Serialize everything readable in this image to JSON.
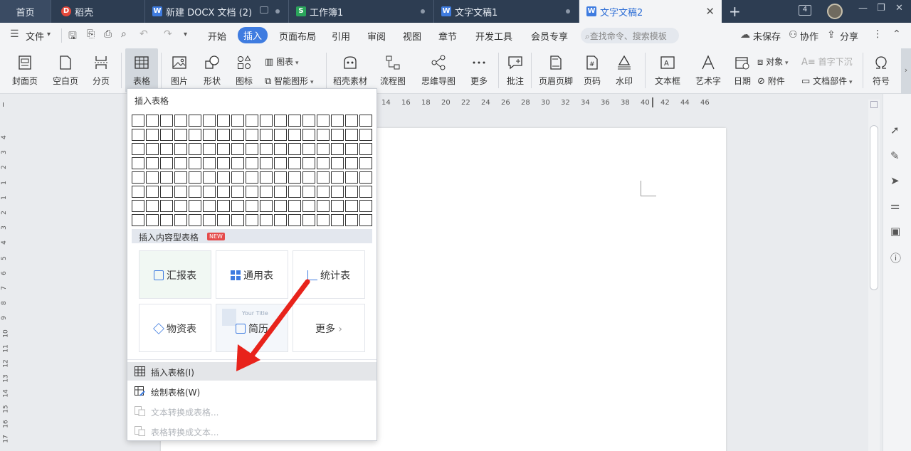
{
  "tabs": {
    "home": "首页",
    "daoke": "稻壳",
    "doc_new": "新建 DOCX 文档 (2)",
    "workbook": "工作簿1",
    "wendoc1": "文字文稿1",
    "wendoc2": "文字文稿2",
    "add": "+",
    "badge_count": "4"
  },
  "menubar": {
    "file": "文件",
    "items": [
      "开始",
      "插入",
      "页面布局",
      "引用",
      "审阅",
      "视图",
      "章节",
      "开发工具",
      "会员专享"
    ],
    "active": "插入",
    "search_placeholder": "查找命令、搜索模板",
    "unsaved": "未保存",
    "collab": "协作",
    "share": "分享"
  },
  "ribbon": {
    "cover": "封面页",
    "blank": "空白页",
    "pagebreak": "分页",
    "table": "表格",
    "picture": "图片",
    "shape": "形状",
    "icon": "图标",
    "chart": "图表",
    "smartart": "智能图形",
    "daoke_material": "稻壳素材",
    "flowchart": "流程图",
    "mindmap": "思维导图",
    "more": "更多",
    "comment": "批注",
    "header_footer": "页眉页脚",
    "page_number": "页码",
    "watermark": "水印",
    "textbox": "文本框",
    "wordart": "艺术字",
    "date": "日期",
    "object": "对象",
    "attachment": "附件",
    "dropcap": "首字下沉",
    "docpart": "文档部件",
    "symbol": "符号"
  },
  "ruler": {
    "h_ticks": [
      "14",
      "16",
      "18",
      "20",
      "22",
      "24",
      "26",
      "28",
      "30",
      "32",
      "34",
      "36",
      "38",
      "40",
      "42",
      "44",
      "46"
    ],
    "v_ticks": [
      "4",
      "3",
      "2",
      "1",
      "1",
      "2",
      "3",
      "4",
      "5",
      "6",
      "7",
      "8",
      "9",
      "10",
      "11",
      "12",
      "13",
      "14",
      "15",
      "16",
      "17"
    ]
  },
  "dropdown": {
    "title": "插入表格",
    "grid_rows": 8,
    "grid_cols": 17,
    "section_label": "插入内容型表格",
    "new_badge": "NEW",
    "cards": [
      "汇报表",
      "通用表",
      "统计表",
      "物资表",
      "简历",
      "更多"
    ],
    "card_preview_text": "Your Title",
    "insert_table": "插入表格(I)",
    "draw_table": "绘制表格(W)",
    "text_to_table": "文本转换成表格...",
    "table_to_text": "表格转换成文本..."
  },
  "colors": {
    "tabbar_bg": "#2d3d52",
    "accent": "#3f7ce0",
    "annotation_arrow": "#e8231b"
  }
}
